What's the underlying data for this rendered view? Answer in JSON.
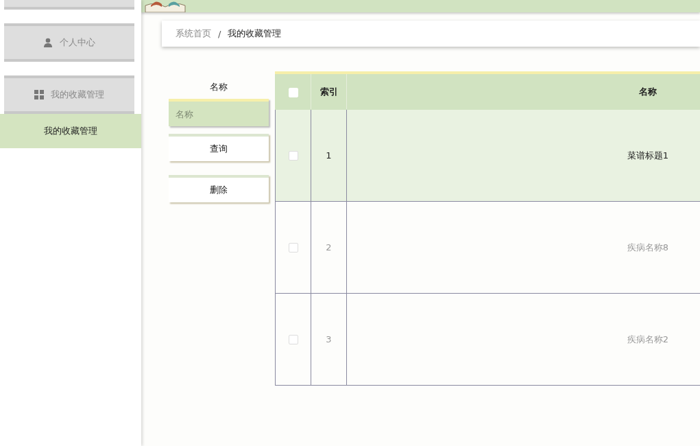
{
  "sidebar": {
    "items": [
      {
        "kind": "blank",
        "selected": false
      },
      {
        "label": "个人中心",
        "kind": "person",
        "selected": false
      },
      {
        "label": "我的收藏管理",
        "kind": "grid",
        "selected": false,
        "children": [
          {
            "label": "我的收藏管理",
            "selected": true
          }
        ]
      }
    ]
  },
  "breadcrumb": [
    "系统首页",
    "我的收藏管理"
  ],
  "breadcrumb_separator": "/",
  "search": {
    "label": "名称",
    "placeholder": "名称"
  },
  "buttons": [
    "查询",
    "删除"
  ],
  "table": {
    "columns": [
      "索引",
      "名称"
    ],
    "header_checkbox": {
      "checked": false
    },
    "rows": [
      {
        "index": "1",
        "name": "菜谱标题1",
        "checked": false,
        "selected": true
      },
      {
        "index": "2",
        "name": "疾病名称8",
        "checked": false,
        "selected": false
      },
      {
        "index": "3",
        "name": "疾病名称2",
        "checked": false,
        "selected": false
      }
    ]
  }
}
